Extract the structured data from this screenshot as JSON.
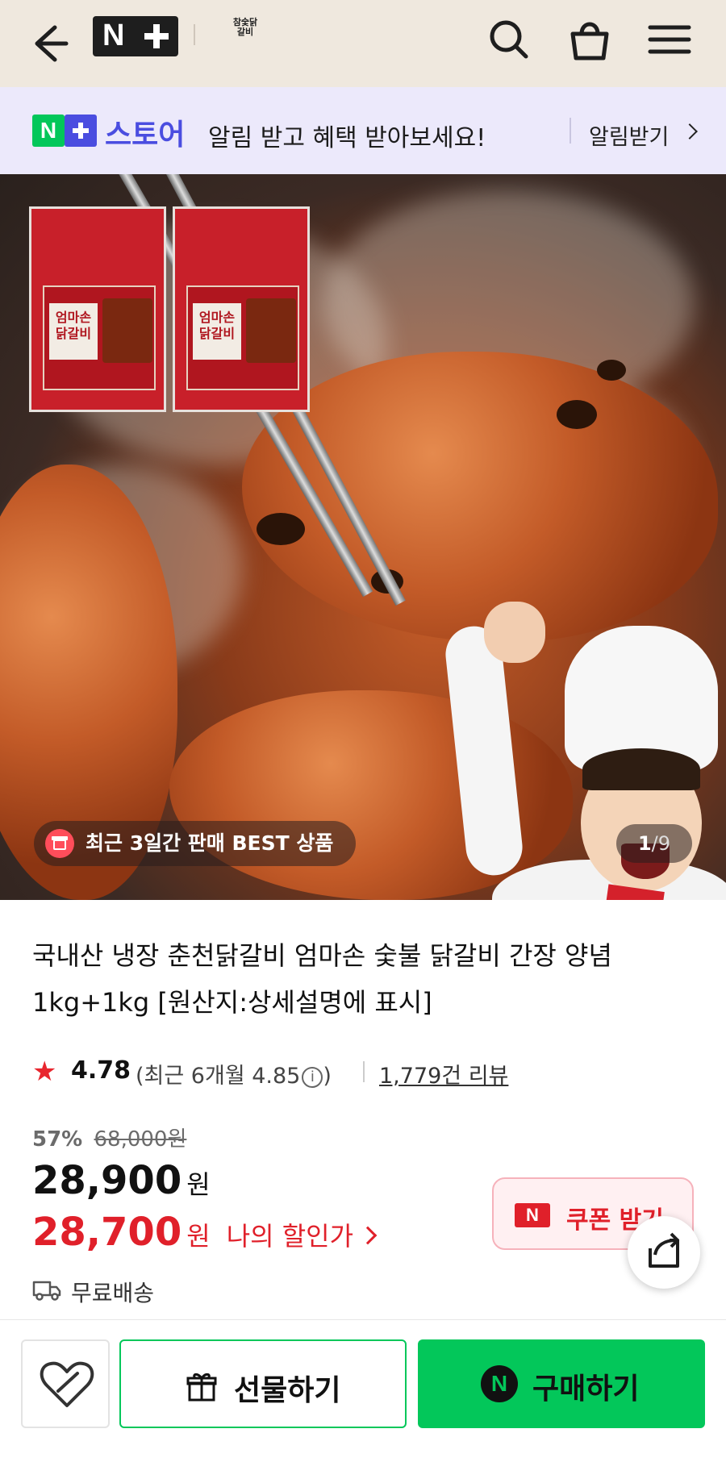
{
  "top_bar": {
    "nplus_letter": "N",
    "brand_logo_lines": [
      "참숯닭",
      "갈비"
    ],
    "icons": [
      "back-arrow-icon",
      "search-icon",
      "shopping-bag-icon",
      "menu-icon"
    ]
  },
  "notice": {
    "badge_letter": "N",
    "store_label": "스토어",
    "message": "알림 받고 혜택 받아보세요!",
    "link_label": "알림받기"
  },
  "hero": {
    "package_labels": [
      "엄마손 닭갈비",
      "엄마손 닭갈비"
    ],
    "best_badge": "최근 3일간 판매 BEST 상품",
    "counter": {
      "current": "1",
      "separator": "/",
      "total": "9"
    }
  },
  "product": {
    "title": "국내산 냉장 춘천닭갈비 엄마손 숯불 닭갈비 간장 양념 1kg+1kg [원산지:상세설명에 표시]",
    "rating": {
      "score": "4.78",
      "recent_prefix": "(최근 6개월 4.85",
      "recent_suffix": ")",
      "info_symbol": "i",
      "review_count": "1,779건 리뷰"
    },
    "price": {
      "discount_rate": "57%",
      "original_price": "68,000원",
      "sale_price": "28,900",
      "currency": "원",
      "my_price": "28,700",
      "my_price_currency": "원",
      "my_price_label": "나의 할인가"
    },
    "coupon": {
      "icon_letter": "N",
      "label": "쿠폰 받기"
    },
    "shipping": "무료배송"
  },
  "bottom_bar": {
    "gift_label": "선물하기",
    "buy_icon_letter": "N",
    "buy_label": "구매하기"
  },
  "colors": {
    "topbar_bg": "#efe8de",
    "notice_bg": "#ece9fb",
    "naver_green": "#03c75a",
    "accent_red": "#e0202a",
    "store_blue": "#4a4de0"
  }
}
